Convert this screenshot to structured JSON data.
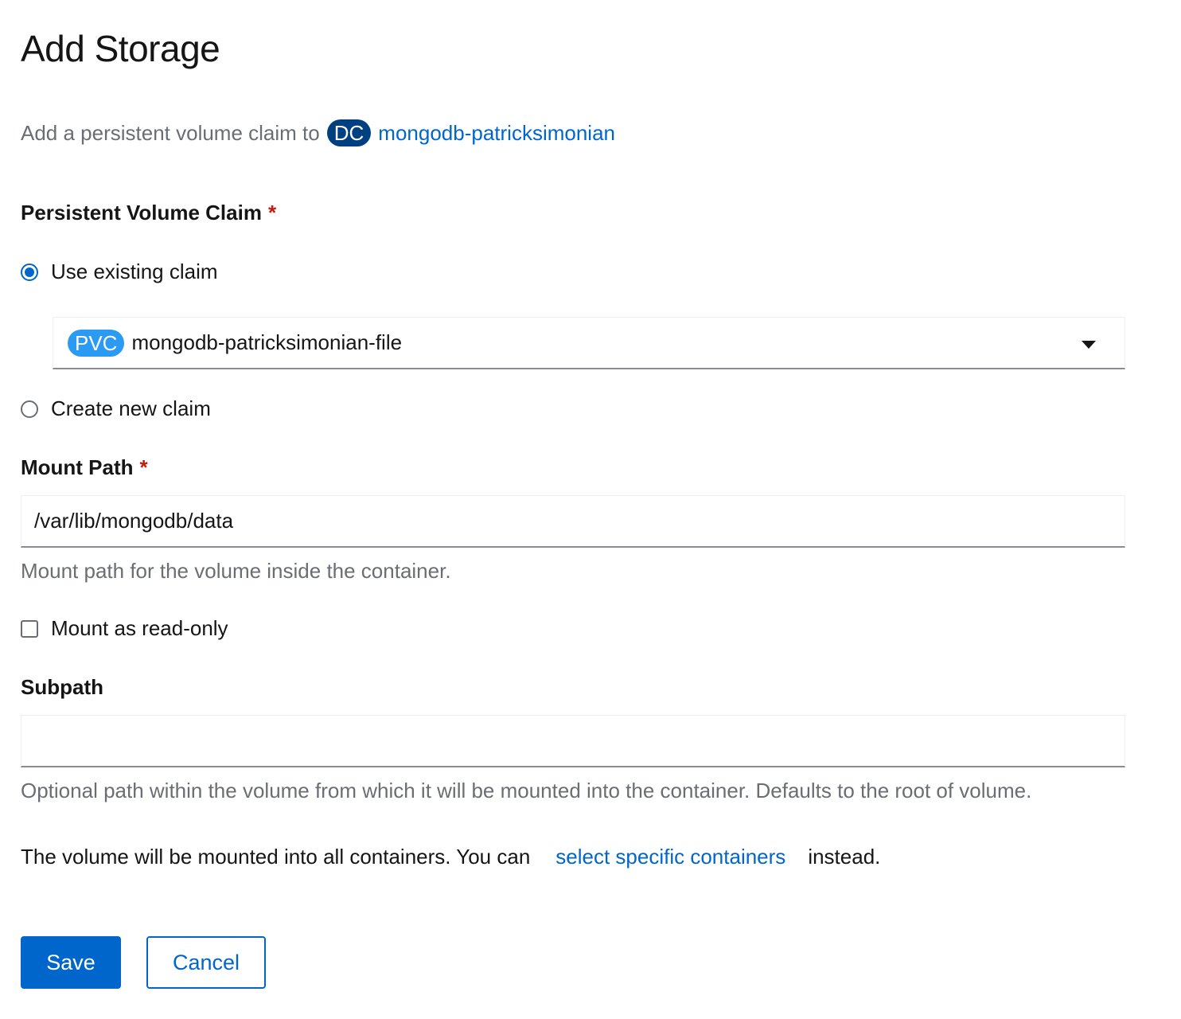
{
  "page": {
    "title": "Add Storage"
  },
  "subtitle": {
    "prefix": "Add a persistent volume claim to",
    "resource_badge": "DC",
    "resource_name": "mongodb-patricksimonian"
  },
  "pvc": {
    "label": "Persistent Volume Claim",
    "required_mark": "*",
    "options": [
      {
        "label": "Use existing claim",
        "selected": true
      },
      {
        "label": "Create new claim",
        "selected": false
      }
    ],
    "select": {
      "badge": "PVC",
      "value": "mongodb-patricksimonian-file"
    }
  },
  "mount_path": {
    "label": "Mount Path",
    "required_mark": "*",
    "value": "/var/lib/mongodb/data",
    "helper": "Mount path for the volume inside the container."
  },
  "read_only": {
    "label": "Mount as read-only",
    "checked": false
  },
  "subpath": {
    "label": "Subpath",
    "value": "",
    "helper": "Optional path within the volume from which it will be mounted into the container. Defaults to the root of volume."
  },
  "containers_note": {
    "prefix": "The volume will be mounted into all containers. You can",
    "link": "select specific containers",
    "suffix": "instead."
  },
  "actions": {
    "save_label": "Save",
    "cancel_label": "Cancel"
  },
  "colors": {
    "primary": "#0066cc",
    "dc_badge": "#004080",
    "pvc_badge": "#2b9af3",
    "required": "#c9190b",
    "muted_text": "#6a6e73"
  }
}
